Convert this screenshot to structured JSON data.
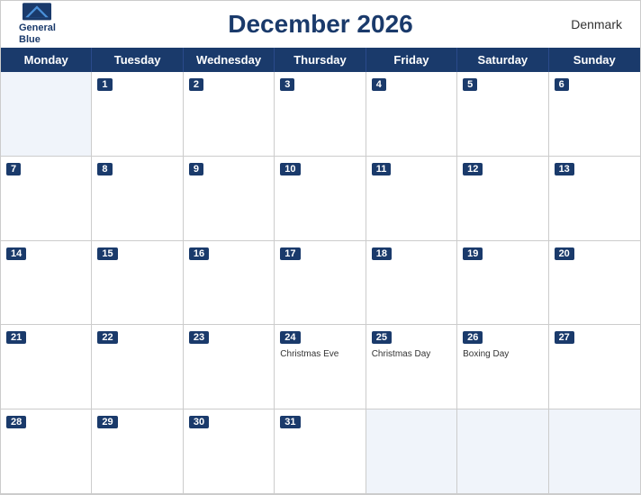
{
  "header": {
    "logo_line1": "General",
    "logo_line2": "Blue",
    "title": "December 2026",
    "country": "Denmark"
  },
  "days_of_week": [
    "Monday",
    "Tuesday",
    "Wednesday",
    "Thursday",
    "Friday",
    "Saturday",
    "Sunday"
  ],
  "weeks": [
    [
      {
        "number": "",
        "empty": true
      },
      {
        "number": "1"
      },
      {
        "number": "2"
      },
      {
        "number": "3"
      },
      {
        "number": "4"
      },
      {
        "number": "5"
      },
      {
        "number": "6"
      }
    ],
    [
      {
        "number": "7"
      },
      {
        "number": "8"
      },
      {
        "number": "9"
      },
      {
        "number": "10"
      },
      {
        "number": "11"
      },
      {
        "number": "12"
      },
      {
        "number": "13"
      }
    ],
    [
      {
        "number": "14"
      },
      {
        "number": "15"
      },
      {
        "number": "16"
      },
      {
        "number": "17"
      },
      {
        "number": "18"
      },
      {
        "number": "19"
      },
      {
        "number": "20"
      }
    ],
    [
      {
        "number": "21"
      },
      {
        "number": "22"
      },
      {
        "number": "23"
      },
      {
        "number": "24",
        "holiday": "Christmas Eve"
      },
      {
        "number": "25",
        "holiday": "Christmas Day"
      },
      {
        "number": "26",
        "holiday": "Boxing Day"
      },
      {
        "number": "27"
      }
    ],
    [
      {
        "number": "28"
      },
      {
        "number": "29"
      },
      {
        "number": "30"
      },
      {
        "number": "31"
      },
      {
        "number": "",
        "empty": true
      },
      {
        "number": "",
        "empty": true
      },
      {
        "number": "",
        "empty": true
      }
    ]
  ],
  "colors": {
    "primary": "#1a3a6b",
    "header_bg": "#fff",
    "grid_border": "#ccc",
    "empty_bg": "#f0f0f0"
  }
}
